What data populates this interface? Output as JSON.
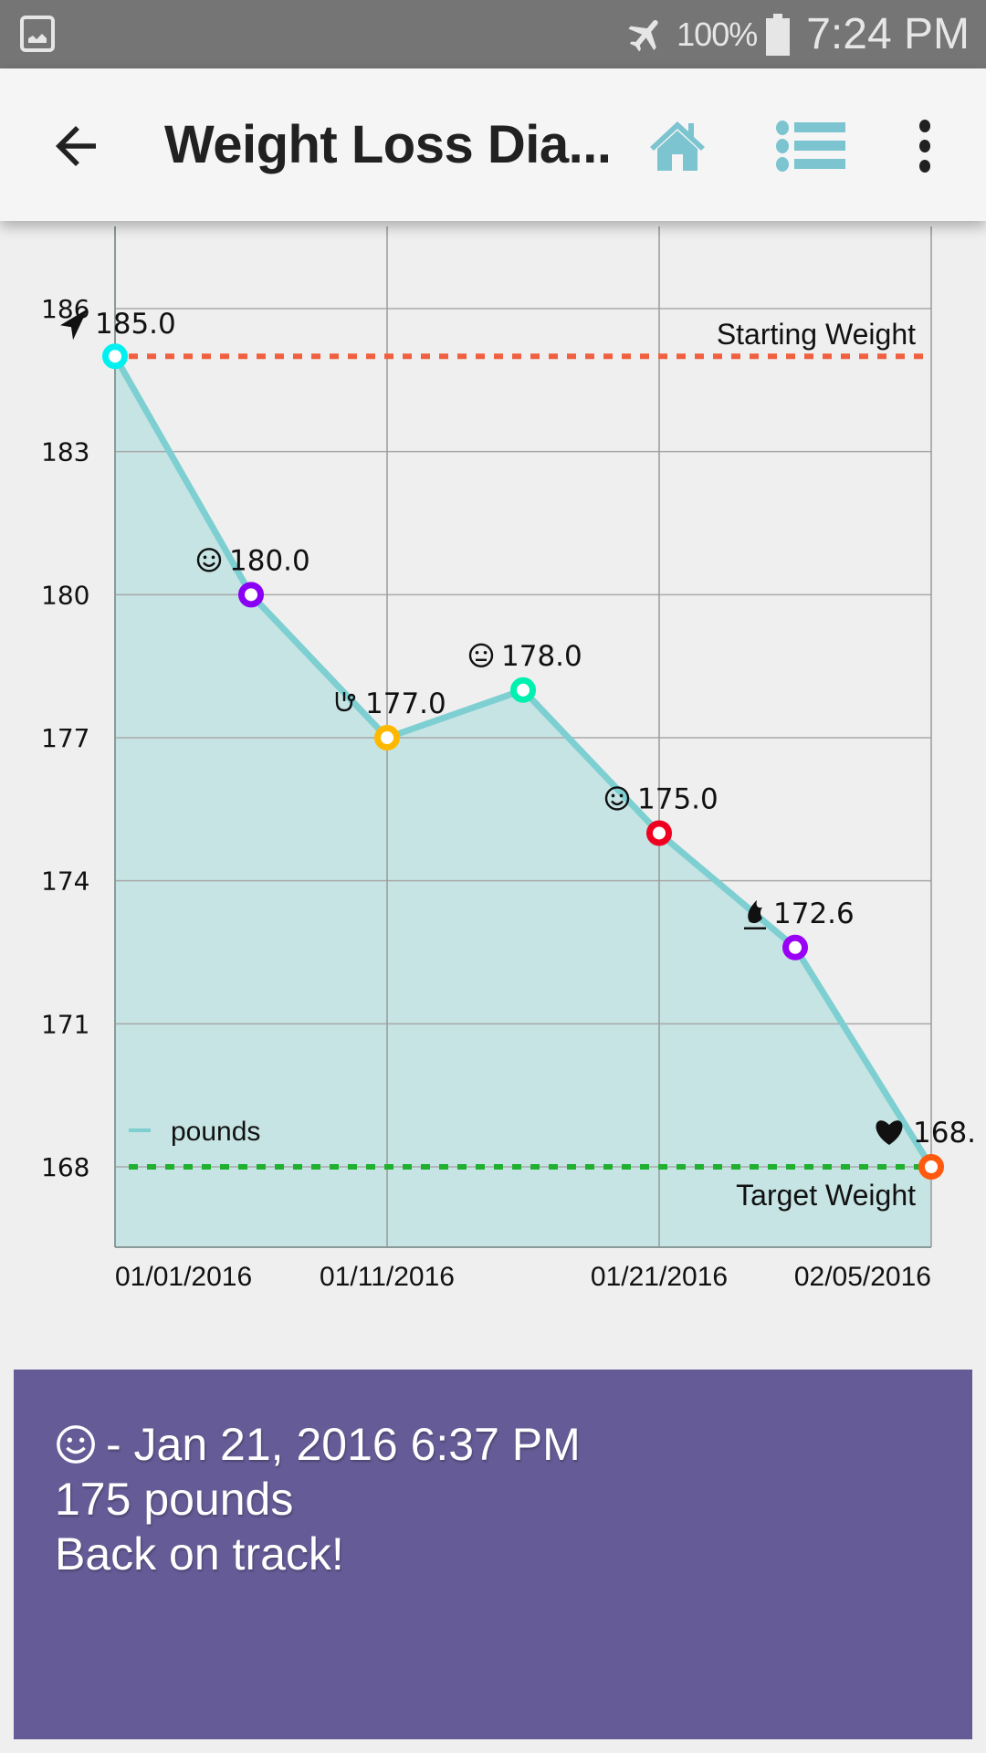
{
  "status_bar": {
    "left_icon": "gallery-icon",
    "airplane_icon": "airplane-mode-icon",
    "battery_percent": "100%",
    "battery_icon": "battery-full-icon",
    "time": "7:24 PM"
  },
  "app_bar": {
    "back_icon": "arrow-back-icon",
    "title": "Weight Loss Dia...",
    "home_icon": "home-icon",
    "list_icon": "list-icon",
    "more_icon": "more-vert-icon",
    "accent_color": "#7bc4d0"
  },
  "chart_data": {
    "type": "area",
    "title": "",
    "xlabel": "",
    "ylabel": "",
    "categories": [
      "01/01/2016",
      "",
      "01/11/2016",
      "",
      "01/21/2016",
      "",
      "02/05/2016"
    ],
    "x_tick_labels": [
      "01/01/2016",
      "01/11/2016",
      "01/21/2016",
      "02/05/2016"
    ],
    "ylim": [
      165.7,
      186
    ],
    "y_ticks": [
      186,
      183,
      180,
      177,
      174,
      171,
      168
    ],
    "grid": true,
    "legend": {
      "position": "bottom-left",
      "entries": [
        "pounds"
      ]
    },
    "series": [
      {
        "name": "pounds",
        "color": "#7ecfd1",
        "fill_color": "#c5e4e3",
        "values": [
          185.0,
          180.0,
          177.0,
          178.0,
          175.0,
          172.6,
          168.0
        ],
        "point_labels": [
          "185.0",
          "180.0",
          "177.0",
          "178.0",
          "175.0",
          "172.6",
          "168."
        ],
        "point_icons": [
          "paper-plane-icon",
          "smiley-icon",
          "stethoscope-icon",
          "neutral-face-icon",
          "smiley-icon",
          "fire-icon",
          "heart-icon"
        ],
        "marker_colors": [
          "#00f0f0",
          "#8a00f5",
          "#ffb800",
          "#00f0b0",
          "#f00020",
          "#9a00f5",
          "#ff5a10"
        ]
      }
    ],
    "reference_lines": [
      {
        "label": "Starting Weight",
        "value": 185.0,
        "color": "#f06040",
        "label_position": "above-right"
      },
      {
        "label": "Target Weight",
        "value": 168.0,
        "color": "#20b030",
        "label_position": "below-right"
      }
    ]
  },
  "detail_card": {
    "background": "#655b96",
    "mood_icon": "smiley-icon",
    "date_line": "- Jan 21, 2016 6:37 PM",
    "weight_line": "175 pounds",
    "note": "Back on track!"
  }
}
